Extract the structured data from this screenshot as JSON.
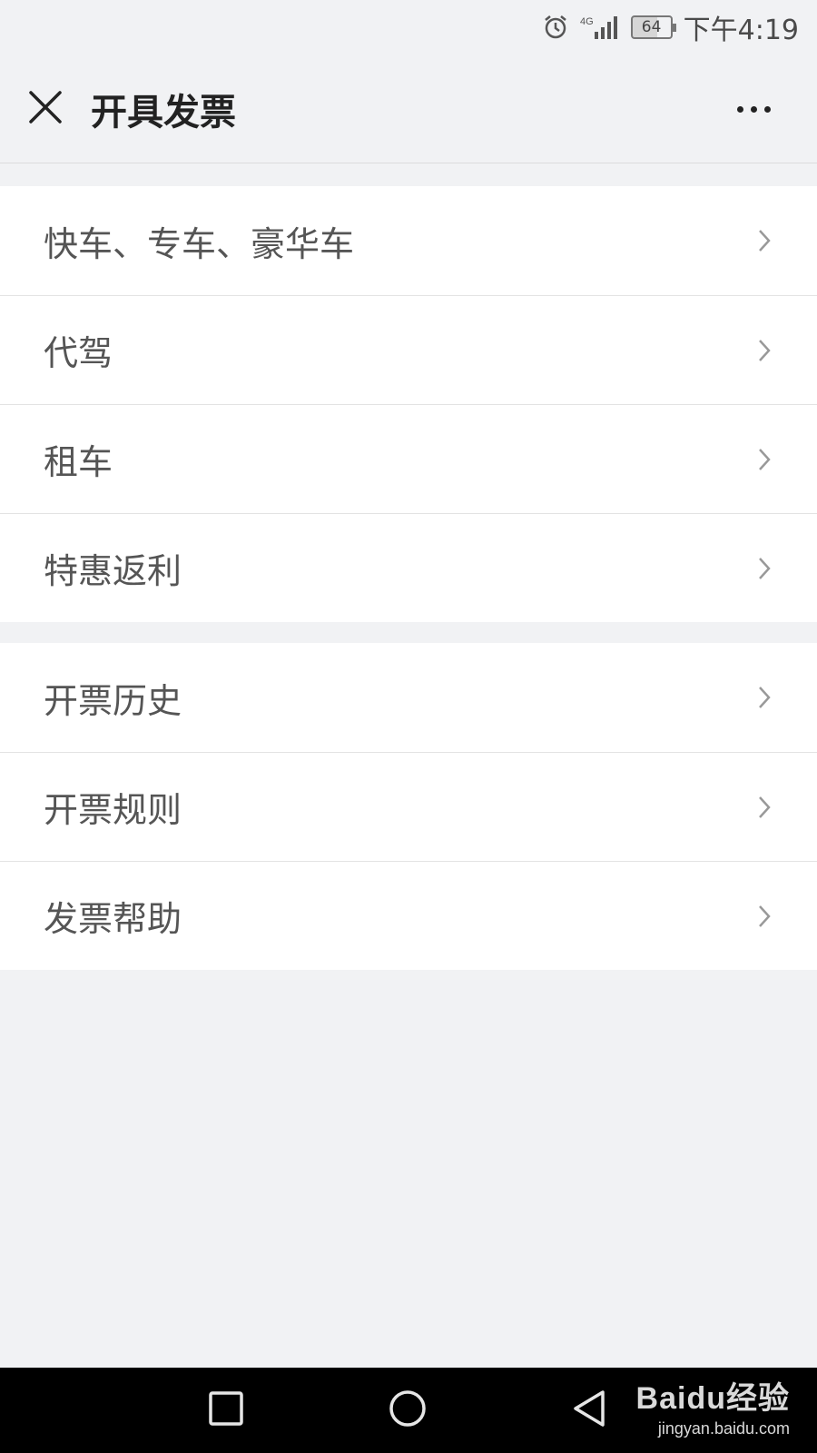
{
  "status_bar": {
    "network": "4G",
    "battery": "64",
    "time": "下午4:19"
  },
  "nav": {
    "title": "开具发票"
  },
  "groups": [
    {
      "items": [
        {
          "label": "快车、专车、豪华车"
        },
        {
          "label": "代驾"
        },
        {
          "label": "租车"
        },
        {
          "label": "特惠返利"
        }
      ]
    },
    {
      "items": [
        {
          "label": "开票历史"
        },
        {
          "label": "开票规则"
        },
        {
          "label": "发票帮助"
        }
      ]
    }
  ],
  "watermark": {
    "brand": "Baidu经验",
    "url": "jingyan.baidu.com"
  },
  "icons": {
    "close": "close-icon",
    "more": "more-dots-icon",
    "chevron": "chevron-right-icon",
    "alarm": "alarm-icon",
    "signal": "signal-icon"
  }
}
